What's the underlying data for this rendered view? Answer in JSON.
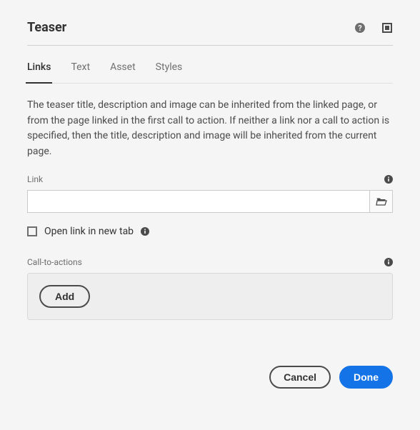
{
  "header": {
    "title": "Teaser"
  },
  "tabs": [
    {
      "label": "Links",
      "active": true
    },
    {
      "label": "Text",
      "active": false
    },
    {
      "label": "Asset",
      "active": false
    },
    {
      "label": "Styles",
      "active": false
    }
  ],
  "panel": {
    "description": "The teaser title, description and image can be inherited from the linked page, or from the page linked in the first call to action. If neither a link nor a call to action is specified, then the title, description and image will be inherited from the current page.",
    "link": {
      "label": "Link",
      "value": ""
    },
    "openNewTab": {
      "label": "Open link in new tab",
      "checked": false
    },
    "cta": {
      "label": "Call-to-actions",
      "addLabel": "Add"
    }
  },
  "footer": {
    "cancel": "Cancel",
    "done": "Done"
  }
}
